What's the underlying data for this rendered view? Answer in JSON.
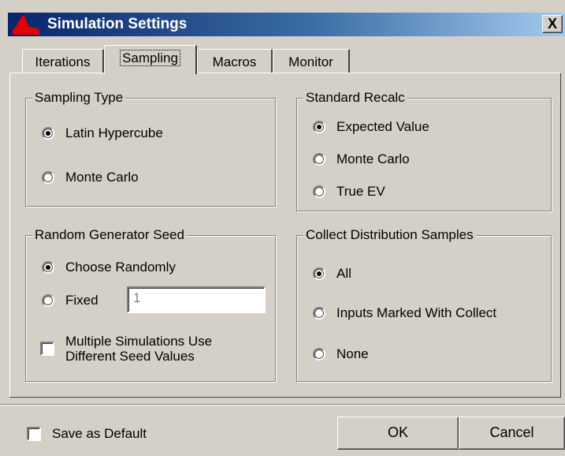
{
  "window": {
    "title": "Simulation Settings",
    "close_label": "X"
  },
  "tabs": [
    {
      "label": "Iterations"
    },
    {
      "label": "Sampling",
      "active": true
    },
    {
      "label": "Macros"
    },
    {
      "label": "Monitor"
    }
  ],
  "sampling_type": {
    "title": "Sampling Type",
    "options": [
      {
        "label": "Latin Hypercube",
        "checked": true
      },
      {
        "label": "Monte Carlo",
        "checked": false
      }
    ]
  },
  "standard_recalc": {
    "title": "Standard Recalc",
    "options": [
      {
        "label": "Expected Value",
        "checked": true
      },
      {
        "label": "Monte Carlo",
        "checked": false
      },
      {
        "label": "True EV",
        "checked": false
      }
    ]
  },
  "random_seed": {
    "title": "Random Generator Seed",
    "options": [
      {
        "label": "Choose Randomly",
        "checked": true
      },
      {
        "label": "Fixed",
        "checked": false
      }
    ],
    "fixed_value": "1",
    "multi_sim_line1": "Multiple Simulations Use",
    "multi_sim_line2": "Different Seed Values",
    "multi_sim_checked": false
  },
  "collect_samples": {
    "title": "Collect Distribution Samples",
    "options": [
      {
        "label": "All",
        "checked": true
      },
      {
        "label": "Inputs Marked With Collect",
        "checked": false
      },
      {
        "label": "None",
        "checked": false
      }
    ]
  },
  "footer": {
    "save_default_label": "Save as Default",
    "save_default_checked": false,
    "ok_label": "OK",
    "cancel_label": "Cancel"
  }
}
